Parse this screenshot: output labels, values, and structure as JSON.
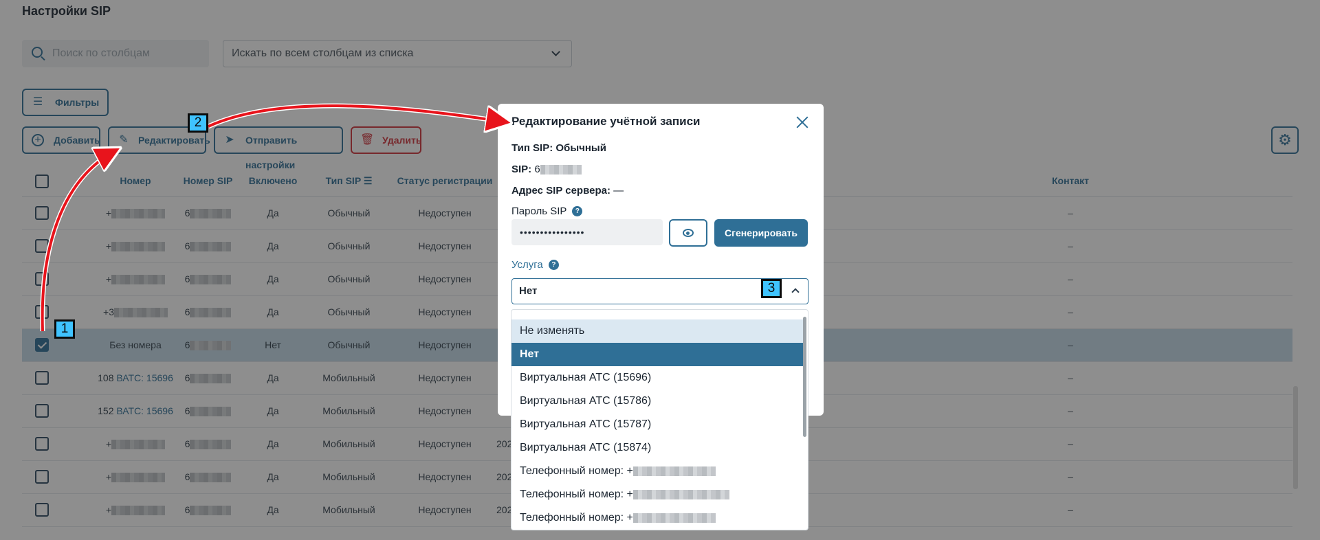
{
  "page": {
    "title": "Настройки SIP",
    "search_placeholder": "Поиск по столбцам",
    "search_all_select": "Искать по всем столбцам из списка"
  },
  "toolbar": {
    "filters": "Фильтры",
    "add": "Добавить",
    "edit": "Редактировать",
    "send_settings": "Отправить настройки",
    "delete": "Удалить"
  },
  "table": {
    "columns": [
      "Номер",
      "Номер SIP",
      "Включено",
      "Тип SIP",
      "Статус регистрации",
      "Контакт"
    ],
    "rows": [
      {
        "number": "+",
        "sip": "6",
        "enabled": "Да",
        "type": "Обычный",
        "status": "Недоступен",
        "contact": "–",
        "selected": false
      },
      {
        "number": "+",
        "sip": "6",
        "enabled": "Да",
        "type": "Обычный",
        "status": "Недоступен",
        "contact": "–",
        "selected": false
      },
      {
        "number": "+",
        "sip": "6",
        "enabled": "Да",
        "type": "Обычный",
        "status": "Недоступен",
        "contact": "–",
        "selected": false
      },
      {
        "number": "+3",
        "sip": "6",
        "enabled": "Да",
        "type": "Обычный",
        "status": "Недоступен",
        "contact": "–",
        "selected": false
      },
      {
        "number": "Без номера",
        "sip": "6",
        "enabled": "Нет",
        "type": "Обычный",
        "status": "Недоступен",
        "contact": "–",
        "selected": true
      },
      {
        "number": "108",
        "number_link": "ВАТС: 15696",
        "sip": "6",
        "enabled": "Да",
        "type": "Мобильный",
        "status": "Недоступен",
        "contact": "–",
        "selected": false
      },
      {
        "number": "152",
        "number_link": "ВАТС: 15696",
        "sip": "6",
        "enabled": "Да",
        "type": "Мобильный",
        "status": "Недоступен",
        "contact": "–",
        "selected": false
      },
      {
        "number": "+",
        "sip": "6",
        "enabled": "Да",
        "type": "Мобильный",
        "status": "Недоступен",
        "date": "202",
        "contact": "–",
        "selected": false
      },
      {
        "number": "+",
        "sip": "6",
        "enabled": "Да",
        "type": "Мобильный",
        "status": "Недоступен",
        "date": "202",
        "contact": "–",
        "selected": false
      },
      {
        "number": "+",
        "sip": "6",
        "enabled": "Да",
        "type": "Мобильный",
        "status": "Недоступен",
        "date": "202",
        "contact": "–",
        "selected": false
      }
    ]
  },
  "modal": {
    "title": "Редактирование учётной записи",
    "sip_type_label": "Тип SIP:",
    "sip_type_value": "Обычный",
    "sip_label": "SIP:",
    "sip_value": "6",
    "server_label": "Адрес SIP сервера:",
    "server_value": "—",
    "password_label": "Пароль SIP",
    "password_value": "••••••••••••••••",
    "generate": "Сгенерировать",
    "service_label": "Услуга",
    "service_value": "Нет",
    "help": "?"
  },
  "dropdown": {
    "options": [
      "Не изменять",
      "Нет",
      "Виртуальная АТС (15696)",
      "Виртуальная АТС (15786)",
      "Виртуальная АТС (15787)",
      "Виртуальная АТС (15874)",
      "Телефонный номер: +",
      "Телефонный номер: +",
      "Телефонный номер: +"
    ],
    "hovered_index": 0,
    "selected_index": 1
  },
  "annotations": [
    "1",
    "2",
    "3"
  ],
  "colors": {
    "accent": "#2f6f96",
    "danger": "#d0323b",
    "badge": "#3fc3ff",
    "arrow": "#e8141c"
  }
}
